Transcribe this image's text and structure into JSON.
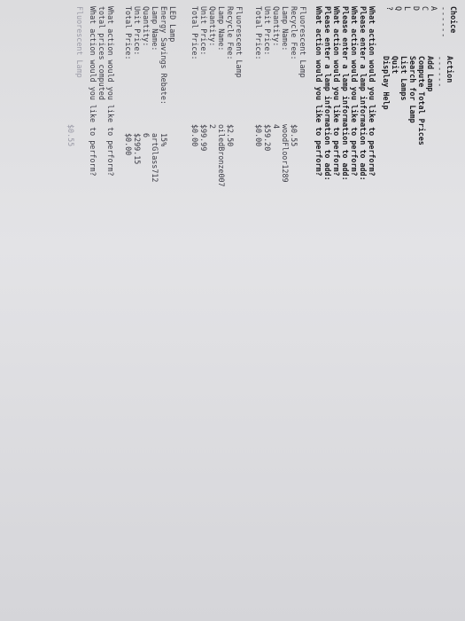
{
  "menu": {
    "choice_header": "Choice",
    "action_header": "Action",
    "separator_choice": "------",
    "separator_action": "------",
    "items": [
      {
        "key": "A",
        "label": "Add Lamp"
      },
      {
        "key": "C",
        "label": "Compute Total Prices"
      },
      {
        "key": "D",
        "label": "Search for Lamp"
      },
      {
        "key": "L",
        "label": "List Lamps"
      },
      {
        "key": "Q",
        "label": "Quit"
      },
      {
        "key": "?",
        "label": "Display Help"
      }
    ]
  },
  "prompts": [
    "What action would you like to perform?",
    "Please enter a lamp information to add:",
    "What action would you like to perform?",
    "Please enter a lamp information to add:",
    "What action would you like to perform?",
    "Please enter a lamp information to add:",
    "What action would you like to perform?"
  ],
  "lamp1": {
    "type": "Fluorescent Lamp",
    "rows": [
      {
        "label": "Recycle Fee:",
        "value": "$0.55"
      },
      {
        "label": "Lamp Name:",
        "value": "woodFloor1289"
      },
      {
        "label": "Quantity:",
        "value": "4"
      },
      {
        "label": "Unit Price:",
        "value": "$59.20"
      },
      {
        "label": "Total Price:",
        "value": "$0.00"
      }
    ]
  },
  "lamp2": {
    "type": "Fluorescent Lamp",
    "rows": [
      {
        "label": "Recycle Fee:",
        "value": "$2.50"
      },
      {
        "label": "Lamp Name:",
        "value": "oiledBronze007"
      },
      {
        "label": "Quantity:",
        "value": "2"
      },
      {
        "label": "Unit Price:",
        "value": "$99.99"
      },
      {
        "label": "Total Price:",
        "value": "$0.00"
      }
    ]
  },
  "lamp3": {
    "type": "LED Lamp",
    "rows": [
      {
        "label": "Energy Savings Rebate:",
        "value": "15%"
      },
      {
        "label": "Lamp Name:",
        "value": "artGlass712"
      },
      {
        "label": "Quantity:",
        "value": "6"
      },
      {
        "label": "Unit Price:",
        "value": "$299.15"
      },
      {
        "label": "Total Price:",
        "value": "$0.00"
      }
    ]
  },
  "after": [
    "What action would you like to perform?",
    "total prices computed",
    "What action would you like to perform?"
  ],
  "trailing": {
    "type": "Fluorescent Lamp",
    "value": "$0.55"
  }
}
